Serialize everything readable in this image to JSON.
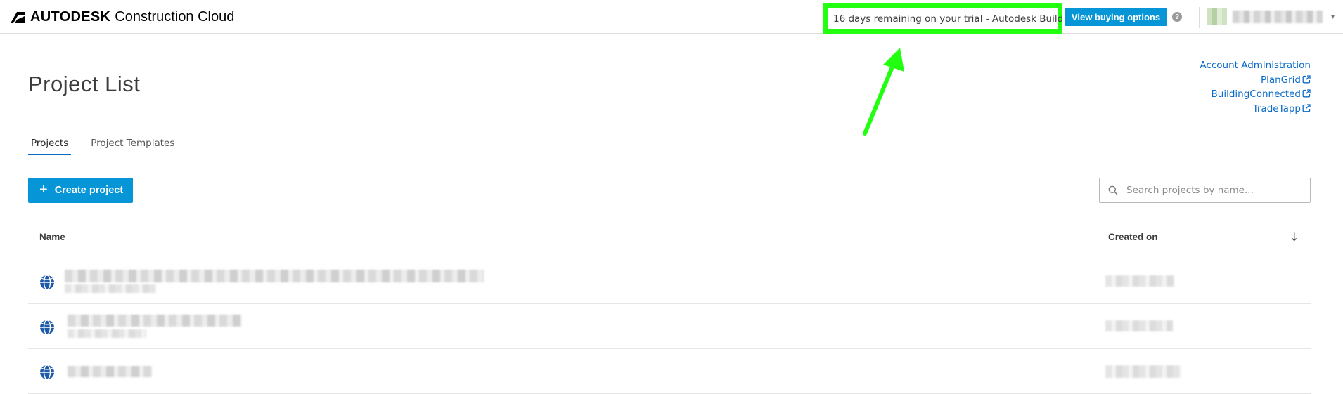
{
  "app": {
    "brand_bold": "AUTODESK",
    "brand_light": "Construction Cloud"
  },
  "topbar": {
    "trial_text": "16 days remaining on your trial - Autodesk Build",
    "buy_label": "View buying options",
    "help_glyph": "?"
  },
  "page": {
    "title": "Project List"
  },
  "links": [
    {
      "label": "Account Administration",
      "external": false
    },
    {
      "label": "PlanGrid",
      "external": true
    },
    {
      "label": "BuildingConnected",
      "external": true
    },
    {
      "label": "TradeTapp",
      "external": true
    }
  ],
  "tabs": [
    {
      "label": "Projects",
      "active": true
    },
    {
      "label": "Project Templates",
      "active": false
    }
  ],
  "actions": {
    "create_label": "Create project",
    "search_placeholder": "Search projects by name..."
  },
  "table": {
    "columns": [
      "Name",
      "Created on"
    ],
    "sort_glyph": "↓"
  },
  "colors": {
    "accent": "#0696d7",
    "link": "#0a6ac9",
    "annotation": "#22ff11"
  }
}
